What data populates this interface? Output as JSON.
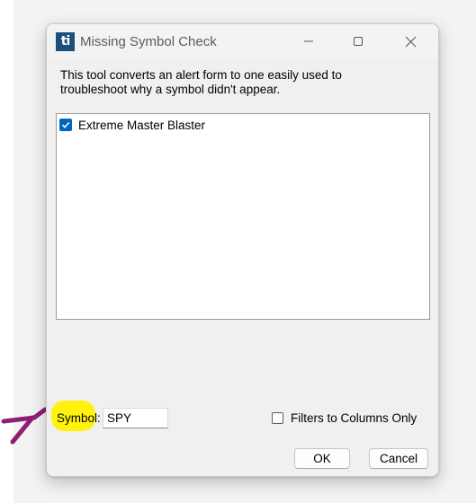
{
  "window": {
    "title": "Missing Symbol Check",
    "icon": "ti-app-icon",
    "icon_text": "ti"
  },
  "description": {
    "line1": "This tool converts an alert form to one easily used to",
    "line2": "troubleshoot why a symbol didn't appear."
  },
  "list": {
    "items": [
      {
        "label": "Extreme Master Blaster",
        "checked": true
      }
    ]
  },
  "symbol": {
    "label": "Symbol:",
    "value": "SPY"
  },
  "filters": {
    "label": "Filters to Columns Only",
    "checked": false
  },
  "buttons": {
    "ok": "OK",
    "cancel": "Cancel"
  },
  "colors": {
    "highlight": "#fff200",
    "arrow": "#8e1f73",
    "checkbox_accent": "#0067c0",
    "icon_bg": "#1b4f7c"
  }
}
